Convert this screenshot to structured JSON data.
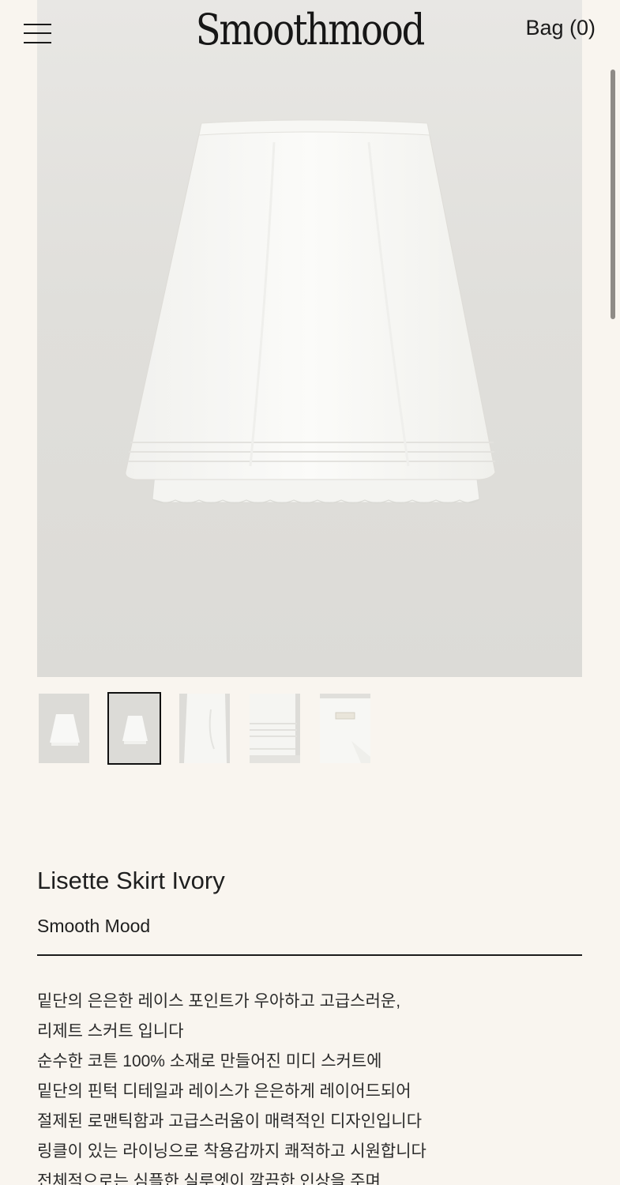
{
  "header": {
    "logo": "Smoothmood",
    "bag_label": "Bag (0)",
    "menu_icon": "hamburger-menu-icon"
  },
  "gallery": {
    "main_image": "white-a-line-skirt-photo",
    "thumbnails": [
      {
        "name": "skirt-front-thumbnail",
        "selected": false
      },
      {
        "name": "skirt-front-small-thumbnail",
        "selected": true
      },
      {
        "name": "skirt-side-detail-thumbnail",
        "selected": false
      },
      {
        "name": "skirt-hem-detail-thumbnail",
        "selected": false
      },
      {
        "name": "skirt-label-detail-thumbnail",
        "selected": false
      }
    ]
  },
  "product": {
    "title": "Lisette Skirt Ivory",
    "brand": "Smooth Mood",
    "description": [
      "밑단의 은은한 레이스 포인트가 우아하고 고급스러운,",
      "리제트 스커트 입니다",
      "순수한 코튼 100% 소재로 만들어진 미디 스커트에",
      "밑단의 핀턱 디테일과 레이스가 은은하게 레이어드되어",
      "절제된 로맨틱함과 고급스러움이 매력적인 디자인입니다",
      "링클이 있는 라이닝으로 착용감까지 쾌적하고 시원합니다",
      "전체적으로는 심플한 실루엣이 깔끔한 인상을 주며"
    ]
  },
  "colors": {
    "background": "#f9f5ef",
    "photo_background": "#e0dfdb",
    "text": "#1a1a1a"
  }
}
